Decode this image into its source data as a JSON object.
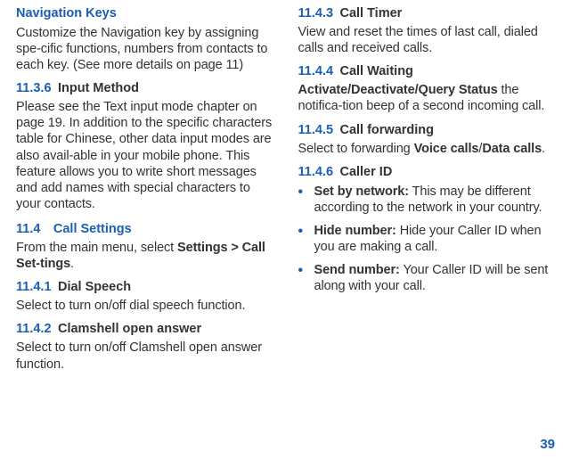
{
  "left": {
    "navkeys_title": "Navigation Keys",
    "navkeys_body": "Customize the Navigation key by assigning spe-cific functions, numbers from contacts to each key. (See more details on page 11)",
    "s1136_num": "11.3.6",
    "s1136_lbl": "Input Method",
    "s1136_body": "Please see the Text input mode chapter on page 19. In addition to the specific characters table for Chinese, other data input modes are also avail-able in your mobile phone. This feature allows you to write short messages and add names with special characters to your contacts.",
    "s114_num": "11.4",
    "s114_lbl": "Call Settings",
    "s114_body_pre": "From the main menu, select ",
    "s114_body_bold": "Settings > Call Set-tings",
    "s114_body_post": ".",
    "s1141_num": "11.4.1",
    "s1141_lbl": "Dial Speech",
    "s1141_body": "Select to turn on/off dial speech function.",
    "s1142_num": "11.4.2",
    "s1142_lbl": "Clamshell open answer",
    "s1142_body": "Select to turn on/off Clamshell open answer function."
  },
  "right": {
    "s1143_num": "11.4.3",
    "s1143_lbl": "Call Timer",
    "s1143_body": "View and reset the times of last call, dialed calls and received calls.",
    "s1144_num": "11.4.4",
    "s1144_lbl": "Call Waiting",
    "s1144_bold": "Activate/Deactivate/Query Status",
    "s1144_rest": " the notifica-tion beep of a second incoming call.",
    "s1145_num": "11.4.5",
    "s1145_lbl": "Call forwarding",
    "s1145_pre": "Select to forwarding ",
    "s1145_b1": "Voice calls",
    "s1145_mid": "/",
    "s1145_b2": "Data calls",
    "s1145_post": ".",
    "s1146_num": "11.4.6",
    "s1146_lbl": "Caller ID",
    "bul1_b": "Set by network:",
    "bul1_t": " This may be different according to the network in your country.",
    "bul2_b": "Hide number:",
    "bul2_t": " Hide your Caller ID when you are making a call.",
    "bul3_b": "Send number:",
    "bul3_t": " Your Caller ID will be sent along with your call."
  },
  "page": "39"
}
